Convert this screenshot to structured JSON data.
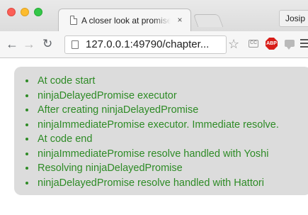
{
  "window": {
    "profile_name": "Josip"
  },
  "tab": {
    "title": "A closer look at promise order",
    "close_glyph": "×"
  },
  "toolbar": {
    "url_host": "127.0.0.1",
    "url_rest": ":49790/chapter...",
    "abp_label": "ABP",
    "cast_label": "CC"
  },
  "log": {
    "entries": [
      "At code start",
      "ninjaDelayedPromise executor",
      "After creating ninjaDelayedPromise",
      "ninjaImmediatePromise executor. Immediate resolve.",
      "At code end",
      "ninjaImmediatePromise resolve handled with Yoshi",
      "Resolving ninjaDelayedPromise",
      "ninjaDelayedPromise resolve handled with Hattori"
    ],
    "color": "#2e8b26"
  },
  "icons": [
    "document-icon",
    "close-icon",
    "back-arrow-icon",
    "forward-arrow-icon",
    "reload-icon",
    "page-info-icon",
    "bookmark-star-icon",
    "cast-icon",
    "adblock-plus-icon",
    "chat-extension-icon",
    "menu-icon"
  ]
}
